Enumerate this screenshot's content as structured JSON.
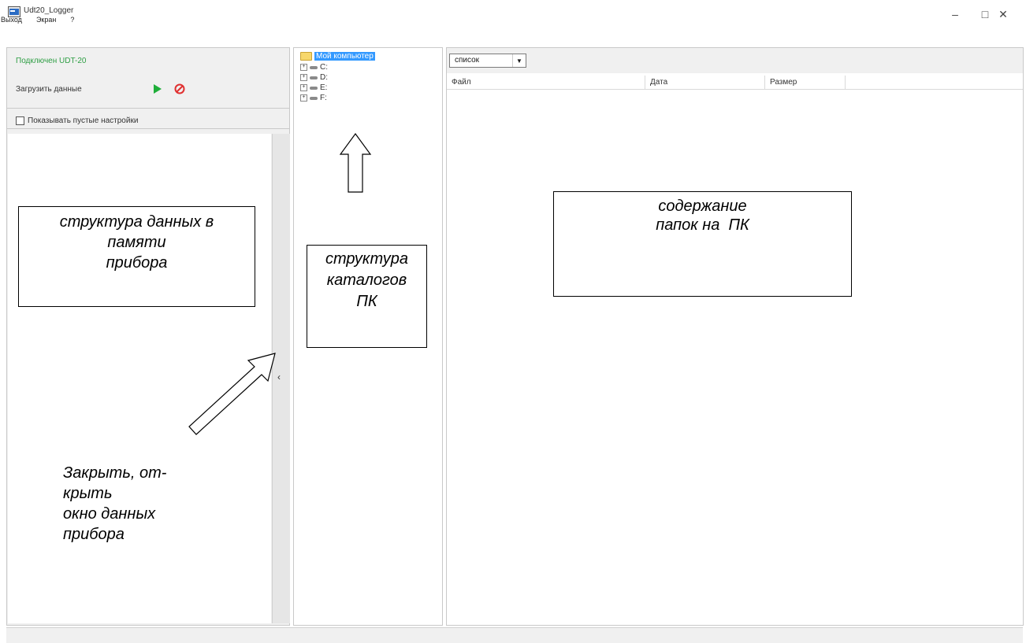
{
  "window": {
    "title": "Udt20_Logger",
    "controls": {
      "minimize": "–",
      "maximize": "□",
      "close": "✕"
    }
  },
  "menu": [
    "Выход",
    "Экран",
    "?"
  ],
  "left_panel": {
    "status": "Подключен UDT-20",
    "load_label": "Загрузить данные",
    "show_empty_label": "Показывать пустые настройки",
    "collapse_glyph": "‹"
  },
  "tree": {
    "root": "Мой компьютер",
    "drives": [
      "C:",
      "D:",
      "E:",
      "F:"
    ]
  },
  "right_panel": {
    "view_selected": "список",
    "columns": [
      "Файл",
      "Дата",
      "Размер"
    ]
  },
  "annotations": {
    "left_box": "структура данных в\nпамяти\nприбора",
    "tree_box": "структура\nкаталогов\nПК",
    "right_box": "содержание\nпапок на  ПК",
    "close_note": "Закрыть, от-\nкрыть\nокно данных\nприбора"
  },
  "colors": {
    "status_green": "#2e9e44",
    "play_green": "#1fae3a",
    "stop_red": "#e03030",
    "selection_blue": "#3399ff"
  }
}
